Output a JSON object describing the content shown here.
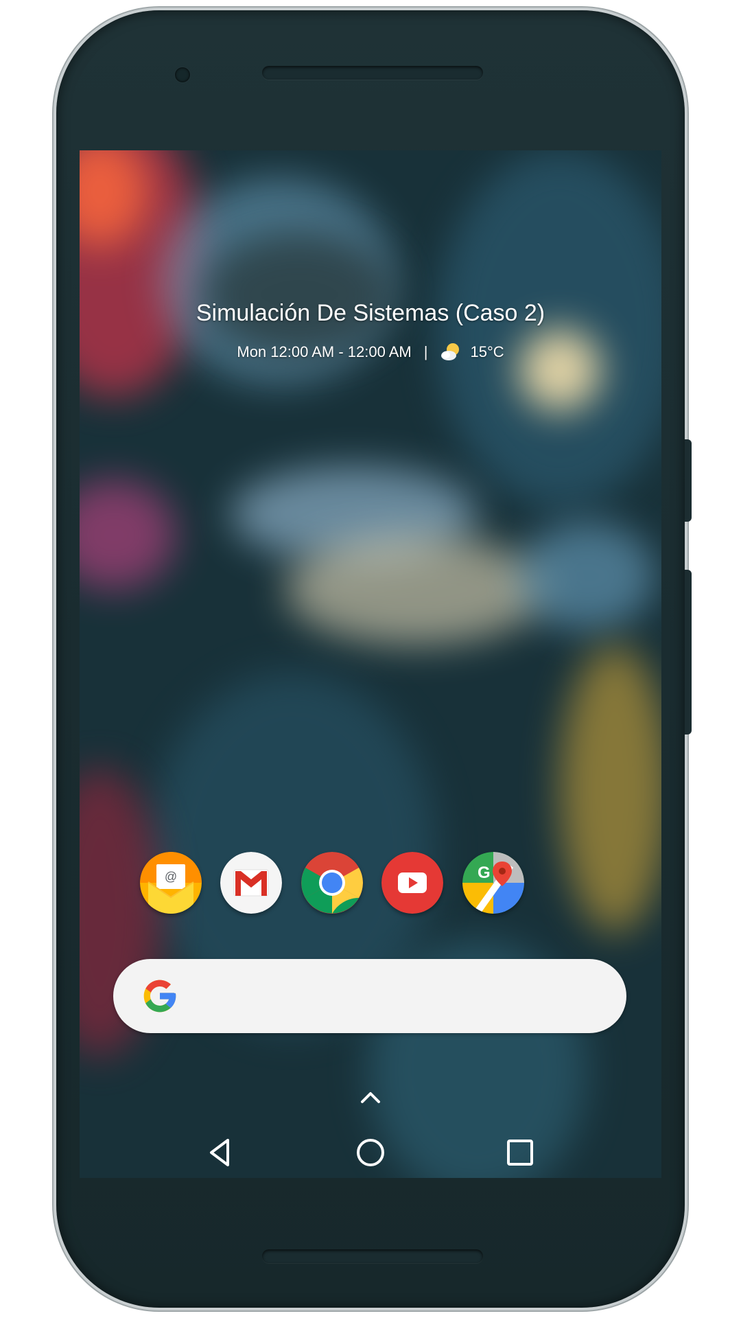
{
  "widget": {
    "event_title": "Simulación De Sistemas (Caso 2)",
    "event_time": "Mon 12:00 AM - 12:00 AM",
    "separator": "|",
    "temperature": "15°C",
    "weather_icon": "partly-cloudy-icon"
  },
  "dock": {
    "apps": [
      {
        "name": "email",
        "icon": "email-app-icon"
      },
      {
        "name": "gmail",
        "icon": "gmail-app-icon"
      },
      {
        "name": "chrome",
        "icon": "chrome-app-icon"
      },
      {
        "name": "youtube",
        "icon": "youtube-app-icon"
      },
      {
        "name": "maps",
        "icon": "maps-app-icon"
      }
    ]
  },
  "search_bar": {
    "logo": "google-g-icon"
  },
  "navigation": {
    "app_drawer": "chevron-up-icon",
    "back": "back-icon",
    "home": "home-icon",
    "recents": "recents-icon"
  },
  "colors": {
    "google_blue": "#4285F4",
    "google_red": "#EA4335",
    "google_yellow": "#FBBC05",
    "google_green": "#34A853",
    "youtube_red": "#E53935",
    "search_bg": "#F3F3F3"
  }
}
